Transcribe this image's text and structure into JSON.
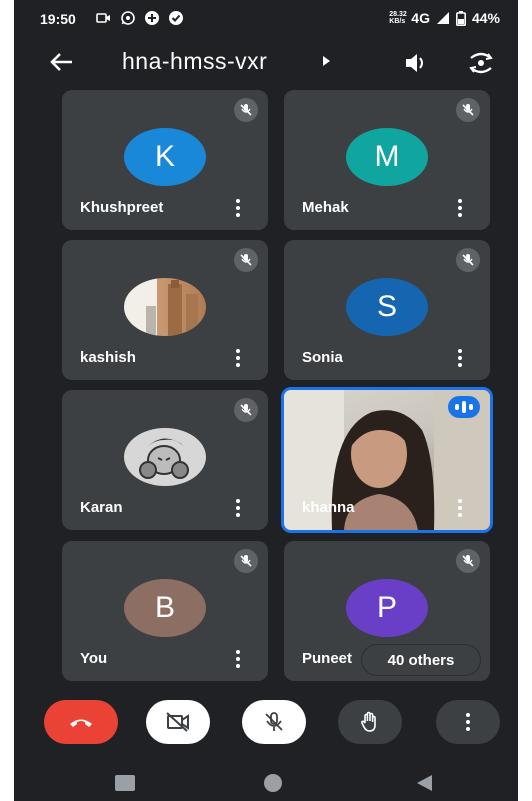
{
  "status_bar": {
    "time": "19:50",
    "speed_value": "28.32",
    "speed_unit": "KB/s",
    "network": "4G",
    "battery": "44%"
  },
  "header": {
    "title": "hna-hmss-vxr",
    "back_icon": "arrow-back-icon",
    "speaker_icon": "speaker-icon",
    "switch_icon": "switch-camera-icon"
  },
  "participants": [
    {
      "name": "Khushpreet",
      "initial": "K",
      "color": "#1a88d8",
      "muted": true
    },
    {
      "name": "Mehak",
      "initial": "M",
      "color": "#11a5a0",
      "muted": true
    },
    {
      "name": "kashish",
      "initial": "",
      "color": "#d6b49a",
      "muted": true,
      "photo": true
    },
    {
      "name": "Sonia",
      "initial": "S",
      "color": "#1565b0",
      "muted": true
    },
    {
      "name": "Karan",
      "initial": "",
      "color": "#cfcfcf",
      "muted": true,
      "photo": true
    },
    {
      "name": "khanna",
      "initial": "",
      "color": "#1a73e8",
      "muted": false,
      "video": true,
      "speaking": true
    },
    {
      "name": "You",
      "initial": "B",
      "color": "#8d6e63",
      "muted": true
    },
    {
      "name": "Puneet",
      "initial": "P",
      "color": "#6a3fc7",
      "muted": true
    }
  ],
  "others_chip": "40 others",
  "controls": {
    "end_call_color": "#ea4335",
    "camera_off": true,
    "mic_off": true
  }
}
